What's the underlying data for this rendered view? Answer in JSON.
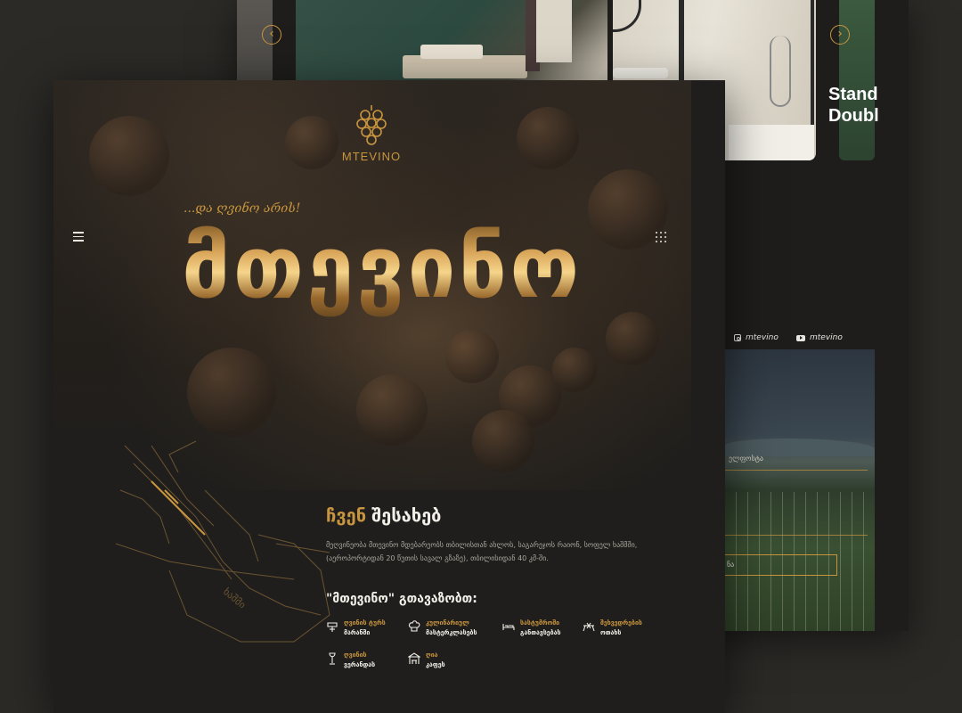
{
  "back": {
    "room_title_line1": "Stand",
    "room_title_line2": "Doubl",
    "social": [
      {
        "icon": "instagram-icon",
        "handle": "mtevino"
      },
      {
        "icon": "youtube-icon",
        "handle": "mtevino"
      }
    ],
    "vineyard_label": "ელფოსტა",
    "vineyard_button": "ნა"
  },
  "header": {
    "logo_text": "MTEVINO",
    "tagline": "...და ღვინო არის!"
  },
  "hero": {
    "title": "მთევინო"
  },
  "about": {
    "title_gold": "ჩვენ",
    "title_white": "შესახებ",
    "text": "მეღვინეობა მთევინო მდებარეობს თბილისთან ახლოს, საგარეჯოს რაიონ, სოფელ ხაშმში, (აეროპორტიდან 20 წუთის სავალ გზაზე), თბილისიდან 40 კმ-ში.",
    "offer_title": "\"მთევინო\" გთავაზობთ:",
    "services": [
      {
        "icon": "wine-tour-icon",
        "line1": "ღვინის ტურს",
        "line2": "მარანში"
      },
      {
        "icon": "chef-hat-icon",
        "line1": "კულინარიულ",
        "line2": "მასტერკლასებს"
      },
      {
        "icon": "bed-icon",
        "line1": "სასტუმროში",
        "line2": "განთავსებას"
      },
      {
        "icon": "event-icon",
        "line1": "შეხვედრების",
        "line2": "ოთახს"
      },
      {
        "icon": "wine-glass-icon",
        "line1": "ღვინის",
        "line2": "ვერანდას"
      },
      {
        "icon": "cafe-icon",
        "line1": "ღია",
        "line2": "კაფეს"
      }
    ]
  },
  "map_label": "ხაშმი",
  "colors": {
    "accent_gold": "#c8953f",
    "background": "#1f1e1c"
  }
}
